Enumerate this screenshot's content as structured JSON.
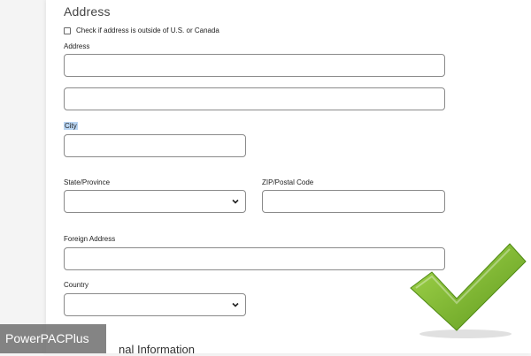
{
  "section": {
    "title": "Address",
    "outside_checkbox_label": "Check if address is outside of U.S. or Canada"
  },
  "fields": {
    "address_label": "Address",
    "address_line1_value": "",
    "address_line2_value": "",
    "city_label": "City",
    "city_value": "",
    "state_label": "State/Province",
    "state_value": "",
    "zip_label": "ZIP/Postal Code",
    "zip_value": "",
    "foreign_address_label": "Foreign Address",
    "foreign_address_value": "",
    "country_label": "Country",
    "country_value": ""
  },
  "next_section_title_visible": "nal Information",
  "watermark_text": "PowerPACPlus",
  "colors": {
    "checkmark_green": "#8cc63f",
    "checkmark_dark": "#5f9a1e",
    "selection_highlight": "#b8d4f2",
    "input_border": "#8a8a8a"
  }
}
